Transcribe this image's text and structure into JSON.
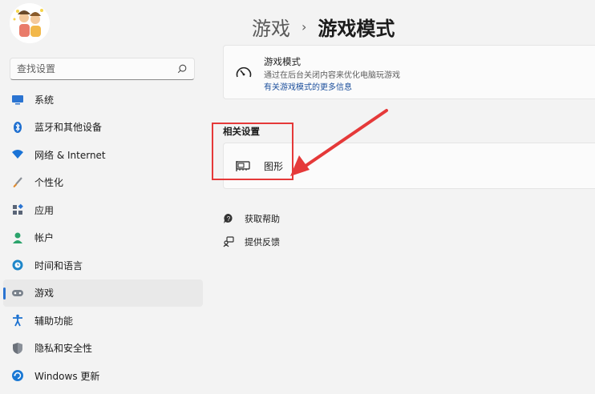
{
  "sidebar": {
    "search_placeholder": "查找设置",
    "items": [
      {
        "label": "系统",
        "icon": "monitor-icon",
        "color": "#2b74d1"
      },
      {
        "label": "蓝牙和其他设备",
        "icon": "bluetooth-icon",
        "color": "#1e6fd0"
      },
      {
        "label": "网络 & Internet",
        "icon": "wifi-icon",
        "color": "#1a73d6"
      },
      {
        "label": "个性化",
        "icon": "brush-icon",
        "color": "#e08a2c"
      },
      {
        "label": "应用",
        "icon": "apps-icon",
        "color": "#5a6577"
      },
      {
        "label": "帐户",
        "icon": "person-icon",
        "color": "#2ba36b"
      },
      {
        "label": "时间和语言",
        "icon": "globe-clock-icon",
        "color": "#1e86c9"
      },
      {
        "label": "游戏",
        "icon": "controller-icon",
        "color": "#7a828c"
      },
      {
        "label": "辅助功能",
        "icon": "accessibility-icon",
        "color": "#1a70d0"
      },
      {
        "label": "隐私和安全性",
        "icon": "shield-icon",
        "color": "#6b717a"
      },
      {
        "label": "Windows 更新",
        "icon": "update-icon",
        "color": "#1a78d4"
      }
    ],
    "active_index": 7
  },
  "breadcrumb": {
    "parent": "游戏",
    "separator": "›",
    "current": "游戏模式"
  },
  "game_mode": {
    "title": "游戏模式",
    "description": "通过在后台关闭内容来优化电脑玩游戏",
    "link": "有关游戏模式的更多信息"
  },
  "related": {
    "title": "相关设置",
    "graphics_label": "图形"
  },
  "help": {
    "get_help": "获取帮助",
    "feedback": "提供反馈"
  },
  "colors": {
    "accent": "#2b74d1",
    "annotation": "#e53939"
  }
}
